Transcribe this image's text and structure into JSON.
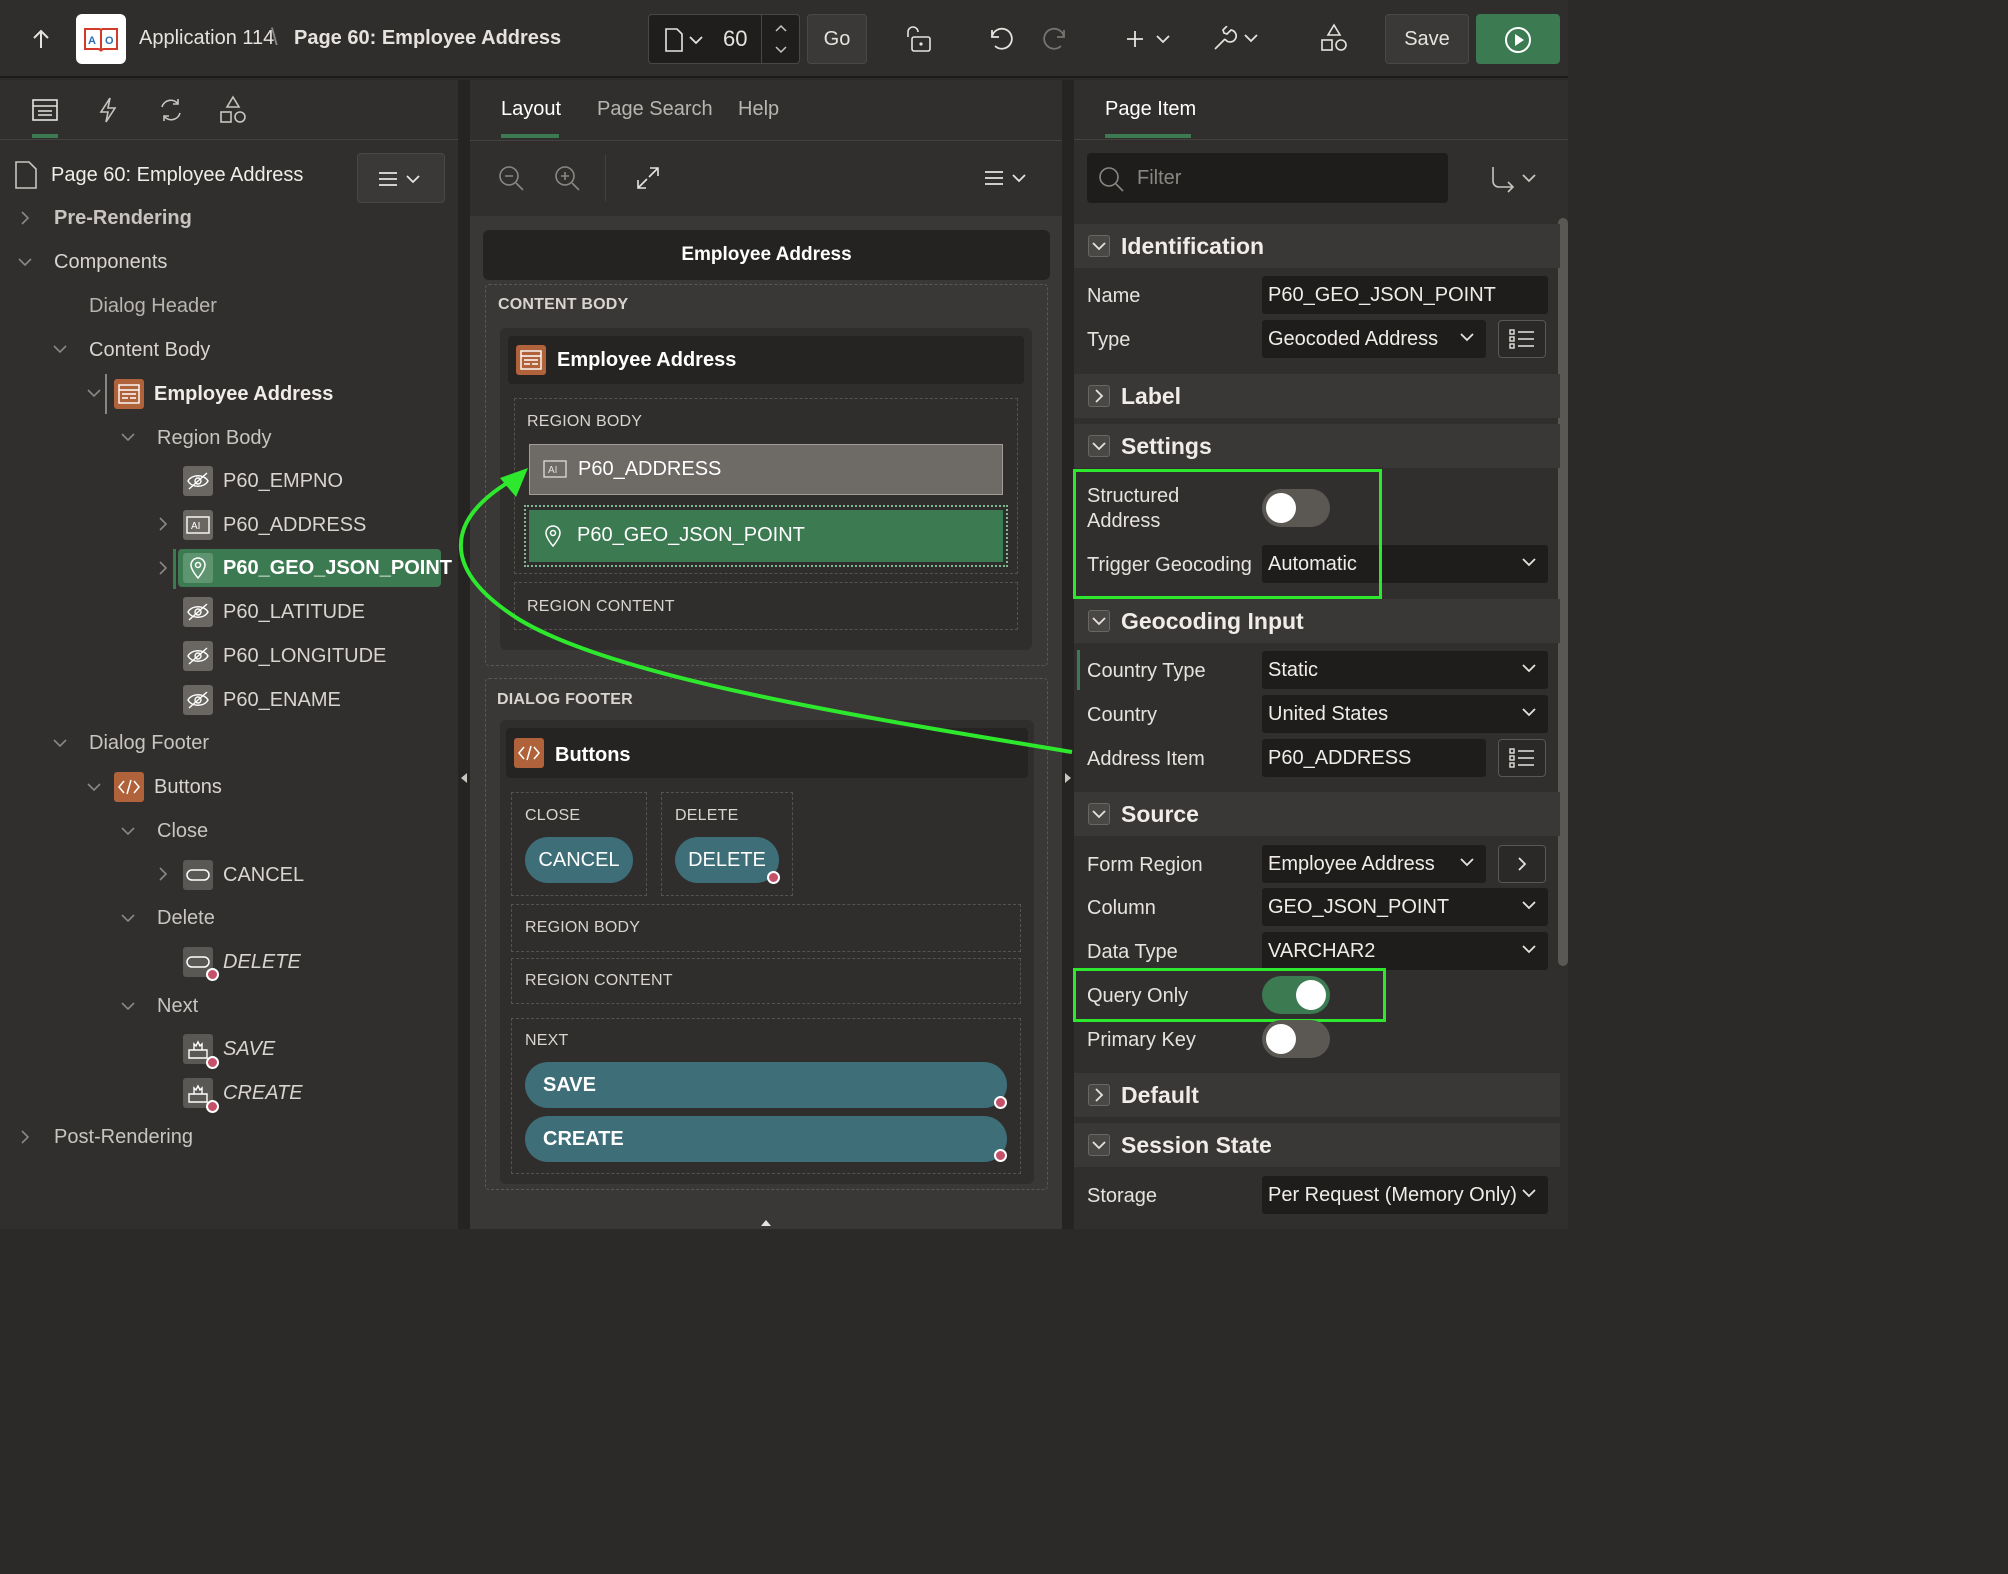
{
  "topbar": {
    "app_name": "Application 114",
    "separator": "\\",
    "page_title": "Page 60: Employee Address",
    "page_number": "60",
    "go_label": "Go",
    "save_label": "Save"
  },
  "left": {
    "page_node": "Page 60: Employee Address",
    "tree": {
      "pre_rendering": "Pre-Rendering",
      "components": "Components",
      "dialog_header": "Dialog Header",
      "content_body": "Content Body",
      "employee_address": "Employee Address",
      "region_body": "Region Body",
      "items": [
        "P60_EMPNO",
        "P60_ADDRESS",
        "P60_GEO_JSON_POINT",
        "P60_LATITUDE",
        "P60_LONGITUDE",
        "P60_ENAME"
      ],
      "dialog_footer": "Dialog Footer",
      "buttons": "Buttons",
      "close": "Close",
      "cancel": "CANCEL",
      "delete_group": "Delete",
      "delete_btn": "DELETE",
      "next": "Next",
      "save_btn": "SAVE",
      "create_btn": "CREATE",
      "post_rendering": "Post-Rendering"
    }
  },
  "center": {
    "tabs": [
      "Layout",
      "Page Search",
      "Help"
    ],
    "dialog_title": "Employee Address",
    "content_body": "CONTENT BODY",
    "region_title": "Employee Address",
    "region_body": "REGION BODY",
    "item_address": "P60_ADDRESS",
    "item_geo": "P60_GEO_JSON_POINT",
    "region_content": "REGION CONTENT",
    "dialog_footer": "DIALOG FOOTER",
    "buttons_title": "Buttons",
    "close_label": "CLOSE",
    "cancel_btn": "CANCEL",
    "delete_label": "DELETE",
    "delete_btn": "DELETE",
    "footer_region_body": "REGION BODY",
    "footer_region_content": "REGION CONTENT",
    "next_label": "NEXT",
    "save_btn": "SAVE",
    "create_btn": "CREATE"
  },
  "right": {
    "tab": "Page Item",
    "filter_placeholder": "Filter",
    "sections": {
      "identification": "Identification",
      "label": "Label",
      "settings": "Settings",
      "geocoding_input": "Geocoding Input",
      "source": "Source",
      "default": "Default",
      "session_state": "Session State"
    },
    "props": {
      "name_label": "Name",
      "name_value": "P60_GEO_JSON_POINT",
      "type_label": "Type",
      "type_value": "Geocoded Address",
      "structured_label_1": "Structured",
      "structured_label_2": "Address",
      "trigger_label": "Trigger Geocoding",
      "trigger_value": "Automatic",
      "country_type_label": "Country Type",
      "country_type_value": "Static",
      "country_label": "Country",
      "country_value": "United States",
      "address_item_label": "Address Item",
      "address_item_value": "P60_ADDRESS",
      "form_region_label": "Form Region",
      "form_region_value": "Employee Address",
      "column_label": "Column",
      "column_value": "GEO_JSON_POINT",
      "data_type_label": "Data Type",
      "data_type_value": "VARCHAR2",
      "query_only_label": "Query Only",
      "primary_key_label": "Primary Key",
      "storage_label": "Storage",
      "storage_value": "Per Request (Memory Only)"
    },
    "toggles": {
      "structured_address": false,
      "query_only": true,
      "primary_key": false
    }
  },
  "colors": {
    "accent_green": "#3c7a52",
    "highlight": "#2ee82e",
    "button_teal": "#3e6e78",
    "region_icon": "#b0623a"
  }
}
